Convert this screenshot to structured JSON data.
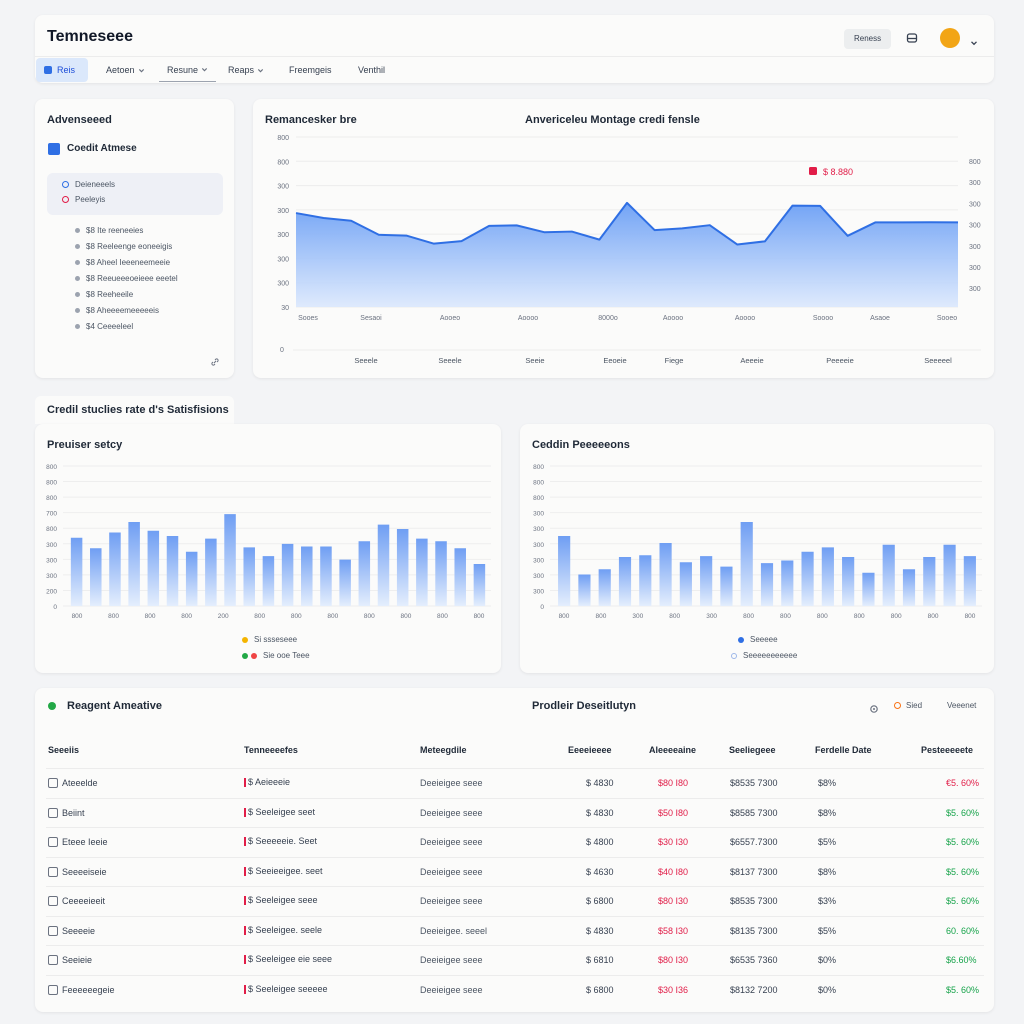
{
  "header": {
    "title": "Temneseee",
    "action_label": "Reness",
    "nav": [
      {
        "label": "Reis",
        "active": true
      },
      {
        "label": "Aetoen",
        "caret": true
      },
      {
        "label": "Resune",
        "caret": true
      },
      {
        "label": "Reaps",
        "caret": true
      },
      {
        "label": "Freemgeis"
      },
      {
        "label": "Venthil"
      }
    ]
  },
  "sidebar": {
    "title": "Advenseeed",
    "section_label": "Coedit Atmese",
    "filters": [
      "Deieneeels",
      "Peeleyis"
    ],
    "items": [
      "$8 Ite reeneeies",
      "$8 Reeleenge eoneeigis",
      "$8 Aheel Ieeeneemeeie",
      "$8 Reeueeeoeieee eeetel",
      "$8 Reeheeile",
      "$8 Aheeeemeeeeeis",
      "$4 Ceeeeleel"
    ]
  },
  "top_chart": {
    "left_title": "Remancesker bre",
    "right_title": "Anvericeleu Montage credi fensle",
    "callout": "$ 8.880",
    "colors": {
      "line": "#2f6fe4",
      "fill_top": "#6b9ff5",
      "fill_bottom": "#dbe8fd",
      "callout": "#e11d48"
    }
  },
  "chart_data": [
    {
      "type": "area",
      "title": "Anvericeleu Montage credi fensle",
      "x": [
        0,
        1,
        2,
        3,
        4,
        5,
        6,
        7,
        8,
        9,
        10,
        11,
        12,
        13,
        14,
        15,
        16,
        17,
        18,
        19,
        20,
        21,
        22,
        23,
        24
      ],
      "values": [
        442,
        419,
        406,
        340,
        336,
        298,
        310,
        382,
        384,
        352,
        355,
        317,
        490,
        362,
        370,
        385,
        294,
        309,
        477,
        476,
        335,
        398,
        398,
        399,
        398
      ],
      "ylim": [
        0,
        800
      ],
      "y_ticks_left": [
        "800",
        "800",
        "300",
        "300",
        "300",
        "300",
        "300",
        "30"
      ],
      "y_ticks_right": [
        "800",
        "300",
        "300",
        "300",
        "300",
        "300",
        "300"
      ],
      "x_ticks": [
        "Sooes",
        "Sesaoi",
        "Aooeo",
        "Aoooo",
        "8000o",
        "Aoooo",
        "Aoooo",
        "Soooo",
        "Asaoe",
        "Sooeo"
      ],
      "bottom_zero": "0",
      "bottom_labels": [
        "Seeele",
        "Seeele",
        "Seeie",
        "Eeoeie",
        "Fiege",
        "Aeeeie",
        "Peeeeie",
        "Seeeeel"
      ]
    },
    {
      "type": "bar",
      "title": "Preuiser setcy",
      "values": [
        390,
        330,
        420,
        480,
        430,
        400,
        310,
        385,
        525,
        335,
        285,
        355,
        340,
        340,
        265,
        370,
        465,
        440,
        385,
        370,
        330,
        240
      ],
      "ylim": [
        0,
        800
      ],
      "y_ticks": [
        "800",
        "800",
        "800",
        "700",
        "800",
        "300",
        "300",
        "300",
        "200",
        "0"
      ],
      "x_ticks": [
        "800",
        "800",
        "800",
        "800",
        "200",
        "800",
        "800",
        "800",
        "800",
        "800",
        "800",
        "800"
      ],
      "legend": [
        "Si ssseseee",
        "Sie ooe Teee"
      ]
    },
    {
      "type": "bar",
      "title": "Ceddin Peeeeeons",
      "values": [
        400,
        180,
        210,
        280,
        290,
        360,
        250,
        285,
        225,
        480,
        245,
        260,
        310,
        335,
        280,
        190,
        350,
        210,
        280,
        350,
        285
      ],
      "ylim": [
        0,
        800
      ],
      "y_ticks": [
        "800",
        "800",
        "800",
        "300",
        "300",
        "300",
        "300",
        "300",
        "300",
        "0"
      ],
      "x_ticks": [
        "800",
        "800",
        "300",
        "800",
        "300",
        "800",
        "800",
        "800",
        "800",
        "800",
        "800",
        "800"
      ],
      "legend": [
        "Seeeee",
        "Seeeeeeeeeee"
      ]
    }
  ],
  "mid_section_title": "Credil stuclies rate d's Satisfisions",
  "bottom_charts": {
    "legend_colors": {
      "a1": "#f4b400",
      "a2a": "#22a846",
      "a2b": "#ef4444",
      "b1": "#2f6fe4",
      "b2": "#9db7e8"
    },
    "bar_top": "#6f9ef3",
    "bar_bottom": "#e4eefd"
  },
  "table": {
    "title": "Reagent Ameative",
    "center_title": "Prodleir Deseitlutyn",
    "actions": [
      "Sied",
      "Veeenet"
    ],
    "columns": [
      "Seeeiis",
      "Tenneeeefes",
      "Meteegdile",
      "Eeeeieeee",
      "Aleeeeaine",
      "Seeliegeee",
      "Ferdelle Date",
      "Pesteeeeete"
    ],
    "rows": [
      {
        "name": "Ateeelde",
        "type": "$ Aeieeeie",
        "desc": "Deeieigee seee",
        "a": "$ 4830",
        "b": "$80 I80",
        "c": "$8535 7300",
        "d": "$8%",
        "e": "€5. 60%"
      },
      {
        "name": "Beiint",
        "type": "$ Seeleigee seet",
        "desc": "Deeieigee seee",
        "a": "$ 4830",
        "b": "$50 I80",
        "c": "$8585 7300",
        "d": "$8%",
        "e": "$5. 60%"
      },
      {
        "name": "Eteee Ieeie",
        "type": "$ Seeeeeie. Seet",
        "desc": "Deeieigee seee",
        "a": "$ 4800",
        "b": "$30 I30",
        "c": "$6557.7300",
        "d": "$5%",
        "e": "$5. 60%"
      },
      {
        "name": "Seeeeiseie",
        "type": "$ Seeieeigee. seet",
        "desc": "Deeieigee seee",
        "a": "$ 4630",
        "b": "$40 I80",
        "c": "$8137 7300",
        "d": "$8%",
        "e": "$5. 60%"
      },
      {
        "name": "Ceeeeieeit",
        "type": "$ Seeleigee seee",
        "desc": "Deeieigee seee",
        "a": "$ 6800",
        "b": "$80 I30",
        "c": "$8535 7300",
        "d": "$3%",
        "e": "$5. 60%"
      },
      {
        "name": "Seeeeie",
        "type": "$ Seeleigee. seele",
        "desc": "Deeieigee. seeel",
        "a": "$ 4830",
        "b": "$58 I30",
        "c": "$8135 7300",
        "d": "$5%",
        "e": "60. 60%"
      },
      {
        "name": "Seeieie",
        "type": "$ Seeleigee eie seee",
        "desc": "Deeieigee seee",
        "a": "$ 6810",
        "b": "$80 I30",
        "c": "$6535 7360",
        "d": "$0%",
        "e": "$6.60%"
      },
      {
        "name": "Feeeeeegeie",
        "type": "$ Seeleigee seeeee",
        "desc": "Deeieigee seee",
        "a": "$ 6800",
        "b": "$30 I36",
        "c": "$8132 7200",
        "d": "$0%",
        "e": "$5. 60%"
      }
    ]
  },
  "colors": {
    "accent": "#2f6fe4",
    "negative": "#e11d48",
    "positive": "#16a34a",
    "avatar": "#f2a516",
    "status_dot": "#22a846"
  }
}
